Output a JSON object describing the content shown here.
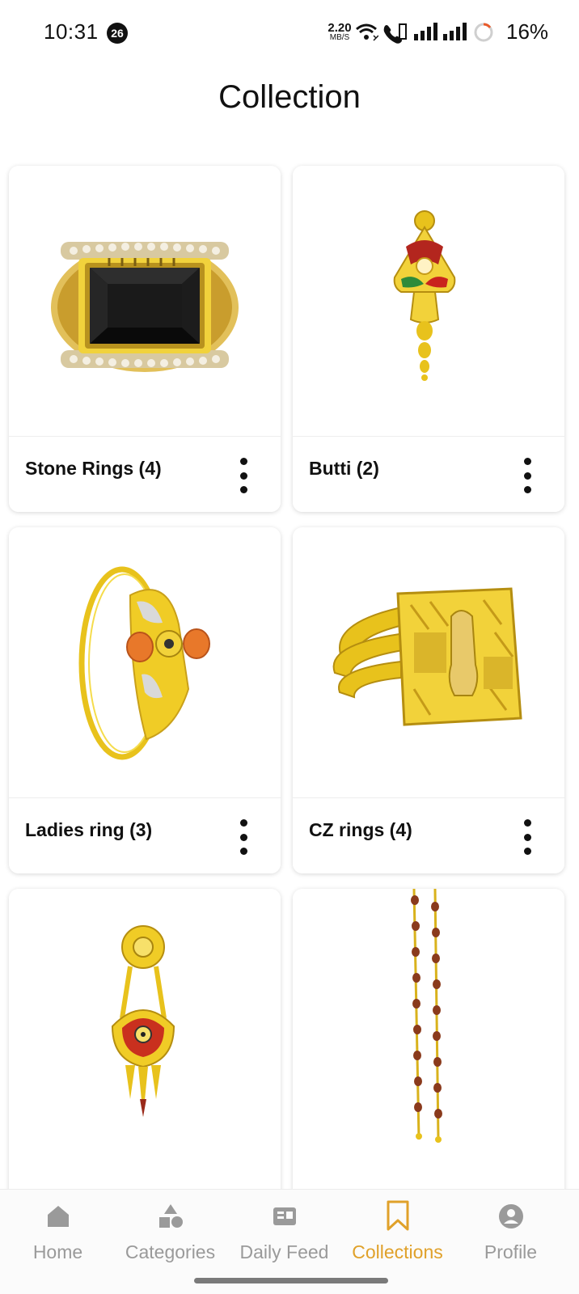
{
  "status_bar": {
    "time": "10:31",
    "notification_count": "26",
    "net_speed_value": "2.20",
    "net_speed_unit": "MB/S",
    "battery": "16%"
  },
  "header": {
    "title": "Collection"
  },
  "collections": [
    {
      "label": "Stone Rings (4)",
      "image_icon": "stone-ring-image"
    },
    {
      "label": "Butti (2)",
      "image_icon": "butti-earring-image"
    },
    {
      "label": "Ladies ring (3)",
      "image_icon": "ladies-ring-image"
    },
    {
      "label": "CZ rings (4)",
      "image_icon": "cz-ring-image"
    },
    {
      "label": "",
      "image_icon": "earring-image"
    },
    {
      "label": "",
      "image_icon": "rudraksha-chain-image"
    }
  ],
  "bottom_nav": {
    "items": [
      {
        "label": "Home",
        "icon": "home-icon"
      },
      {
        "label": "Categories",
        "icon": "categories-icon"
      },
      {
        "label": "Daily Feed",
        "icon": "daily-feed-icon"
      },
      {
        "label": "Collections",
        "icon": "bookmark-icon",
        "active": true
      },
      {
        "label": "Profile",
        "icon": "profile-icon"
      }
    ]
  },
  "colors": {
    "accent": "#e0a12a",
    "nav_inactive": "#9a9a9a",
    "gold": "#e8c21c"
  }
}
